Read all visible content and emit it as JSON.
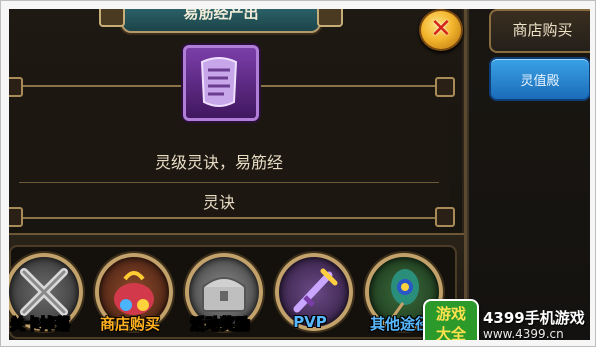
{
  "dialog": {
    "title": "易筋经产出",
    "close_symbol": "✕",
    "item_description": "灵级灵诀，易筋经",
    "item_type": "灵诀"
  },
  "sources": [
    {
      "label": "关卡掉落",
      "color": "#ffffff",
      "icon": "crossed-swords-icon"
    },
    {
      "label": "商店购买",
      "color": "#ffb020",
      "icon": "shop-bag-icon"
    },
    {
      "label": "活动奖励",
      "color": "#ffffff",
      "icon": "treasure-chest-icon"
    },
    {
      "label": "PVP",
      "color": "#58b8ff",
      "icon": "pvp-sword-icon"
    },
    {
      "label": "其他途径",
      "color": "#58b8ff",
      "icon": "feather-icon"
    }
  ],
  "right_panel": {
    "tab_label": "商店购买",
    "button_label": "灵值殿"
  },
  "watermark": {
    "logo_line1": "游戏",
    "logo_line2": "大全",
    "text": "4399手机游戏",
    "url": "www.4399.cn"
  },
  "colors": {
    "title_bar": "#2f6b71",
    "close_button": "#f3b52c",
    "button_blue": "#2b8fd8",
    "gold_border": "#a98b58"
  }
}
